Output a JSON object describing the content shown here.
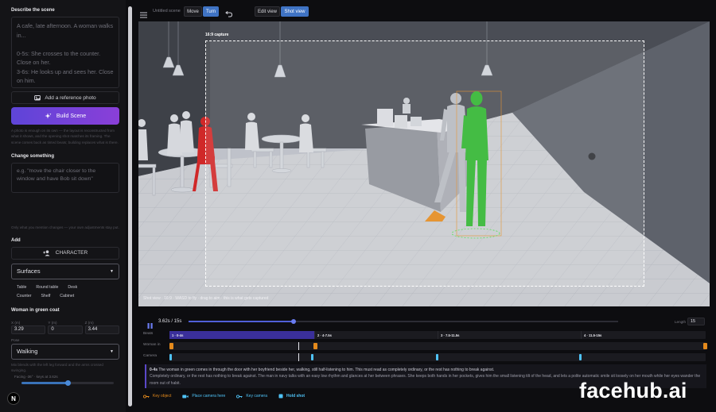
{
  "sidebar": {
    "describe_heading": "Describe the scene",
    "scene_text": "A cafe, late afternoon. A woman walks in...\n\n0-5s: She crosses to the counter. Close on her.\n3-6s: He looks up and sees her. Close on him.",
    "reference_photo_label": "Add a reference photo",
    "build_button_label": "Build Scene",
    "build_hint": "A photo is enough on its own — the layout is reconstructed from what it shows, and the opening shot matches its framing. The scene comes back as tinted beats; building replaces what is there.",
    "change_heading": "Change something",
    "change_placeholder": "e.g. \"move the chair closer to the window and have Bob sit down\"",
    "change_hint": "Only what you mention changes — your own adjustments stay put.",
    "add_heading": "Add",
    "character_button_label": "CHARACTER",
    "surfaces_select": "Surfaces",
    "chips": [
      "Table",
      "Round table",
      "Desk",
      "Counter",
      "Shelf",
      "Cabinet"
    ],
    "selected_heading": "Woman in green coat",
    "coords": [
      {
        "label": "X (m)",
        "value": "3.29"
      },
      {
        "label": "Y (m)",
        "value": "0"
      },
      {
        "label": "Z (m)",
        "value": "3.44"
      }
    ],
    "pose_label": "Pose",
    "pose_select": "Walking",
    "pose_hint": "Mix blends with the left leg forward and the arms crossed swinging.",
    "facing_label": "Facing -36°",
    "facing_hint": "· keys at 3.62s",
    "facing_fraction": 0.5
  },
  "topbar": {
    "scene_name": "Untitled scene",
    "move_label": "Move",
    "turn_label": "Turn",
    "undo_icon": "undo-icon",
    "edit_view_label": "Edit view",
    "shot_view_label": "Shot view"
  },
  "viewport": {
    "capture_label": "16:9 capture",
    "status": "Shot view · 16:9 · WASD to fly · drag to aim · this is what gets captured"
  },
  "timeline": {
    "time_display": "3.62s / 15s",
    "length_label": "Length",
    "length_value": "15",
    "playhead_fraction": 0.245,
    "rows": [
      "Beats",
      "Woman in",
      "Camera"
    ],
    "beats": [
      "1 · 0-4s",
      "2 · 4-7.5s",
      "3 · 7.5-11.5s",
      "4 · 11.5-15s"
    ],
    "description_title": "0-4s",
    "description_line1": "The woman in green comes in through the door with her boyfriend beside her, walking, still half-listening to him. This must read as completely ordinary, or the rest has nothing to break against.",
    "description_line2": "Completely ordinary, or the rest has nothing to break against. The man in navy talks with an easy low rhythm and glances at her between phrases. She keeps both hands in her pockets, gives him the small listening tilt of the head, and lets a polite automatic smile sit loosely on her mouth while her eyes wander the room out of habit.",
    "legend": {
      "key_object": "Key object",
      "place_camera": "Place camera here",
      "key_camera": "Key camera",
      "hold_shot": "Hold shot"
    }
  },
  "colors": {
    "accent": "#3f73c4",
    "build_gradient_start": "#5e45d8",
    "build_gradient_end": "#8a3fd8",
    "beat_active": "#3a2f9a",
    "object_key": "#e48a1c",
    "camera_key": "#4fc3f7",
    "woman_figure": "#2fb52f",
    "man_figure": "#d02828"
  },
  "watermark": "facehub.ai"
}
